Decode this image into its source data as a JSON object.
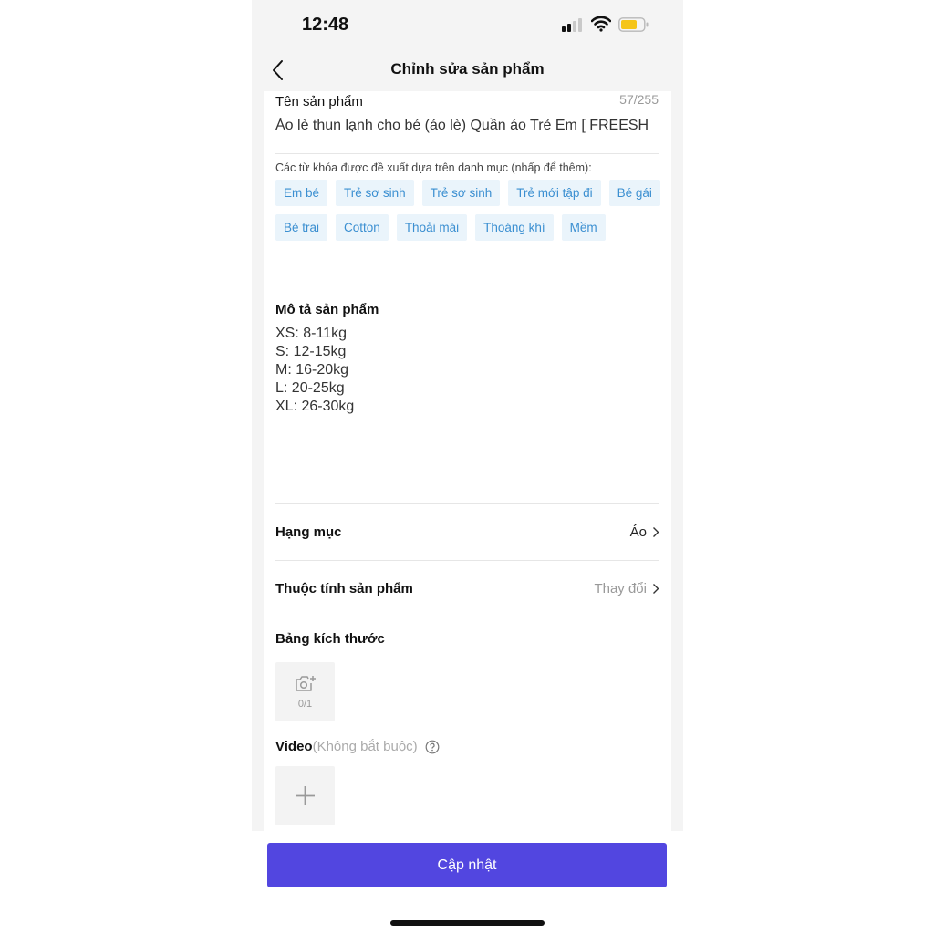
{
  "status_bar": {
    "time": "12:48"
  },
  "header": {
    "title": "Chỉnh sửa sản phẩm"
  },
  "product_name": {
    "label": "Tên sản phẩm",
    "count": "57/255",
    "value": "Áo lè thun lạnh cho bé (áo lè) Quần áo Trẻ Em [ FREESH"
  },
  "keywords": {
    "hint": "Các từ khóa được đề xuất dựa trên danh mục (nhấp để thêm):",
    "items": [
      "Em bé",
      "Trẻ sơ sinh",
      "Trẻ sơ sinh",
      "Trẻ mới tập đi",
      "Bé gái",
      "Bé trai",
      "Cotton",
      "Thoải mái",
      "Thoáng khí",
      "Mềm"
    ]
  },
  "description": {
    "label": "Mô tả sản phẩm",
    "lines": [
      "XS: 8-11kg",
      "S: 12-15kg",
      "M: 16-20kg",
      "L: 20-25kg",
      "XL: 26-30kg"
    ]
  },
  "category": {
    "label": "Hạng mục",
    "value": "Áo"
  },
  "attributes": {
    "label": "Thuộc tính sản phẩm",
    "value": "Thay đổi"
  },
  "size_chart": {
    "label": "Bảng kích thước",
    "count": "0/1"
  },
  "video": {
    "label": "Video",
    "optional": "(Không bắt buộc)"
  },
  "update_button": {
    "label": "Cập nhật",
    "color": "#5246e0"
  },
  "colors": {
    "keyword_bg": "#eaf4fb",
    "keyword_text": "#3b8fd1",
    "battery": "#f5c518"
  }
}
